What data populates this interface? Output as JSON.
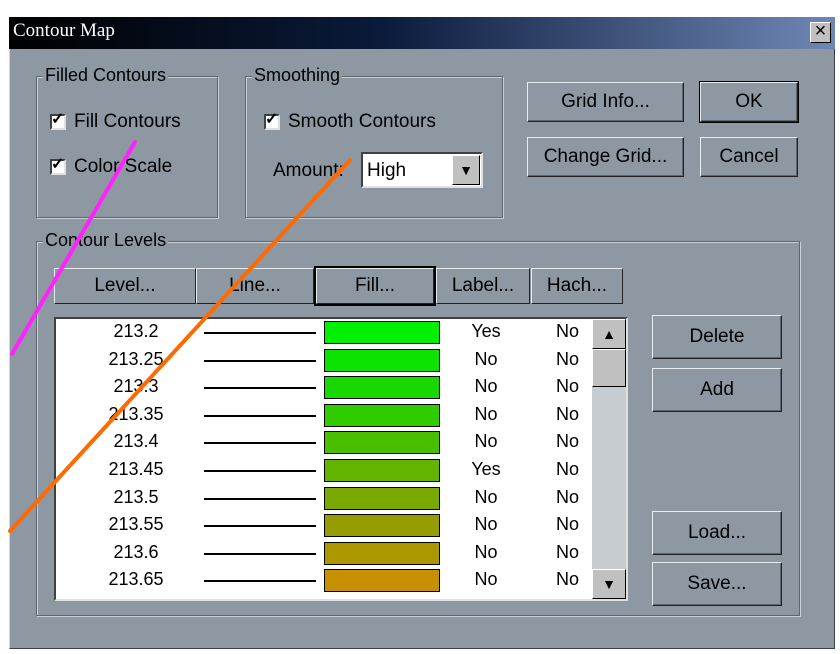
{
  "window": {
    "title": "Contour Map",
    "close_label": "×"
  },
  "filled": {
    "title": "Filled Contours",
    "fill_contours": {
      "label": "Fill Contours",
      "checked": true
    },
    "color_scale": {
      "label": "Color Scale",
      "checked": true
    }
  },
  "smoothing": {
    "title": "Smoothing",
    "smooth": {
      "label": "Smooth Contours",
      "checked": true
    },
    "amount_label": "Amount:",
    "amount_value": "High"
  },
  "buttons": {
    "grid_info": "Grid Info...",
    "ok": "OK",
    "change_grid": "Change Grid...",
    "cancel": "Cancel",
    "delete": "Delete",
    "add": "Add",
    "load": "Load...",
    "save": "Save..."
  },
  "levels": {
    "title": "Contour Levels",
    "headers": [
      "Level...",
      "Line...",
      "Fill...",
      "Label...",
      "Hach..."
    ],
    "rows": [
      {
        "level": "213.2",
        "label": "Yes",
        "hach": "No",
        "color": "#00f000"
      },
      {
        "level": "213.25",
        "label": "No",
        "hach": "No",
        "color": "#0ce300"
      },
      {
        "level": "213.3",
        "label": "No",
        "hach": "No",
        "color": "#19d800"
      },
      {
        "level": "213.35",
        "label": "No",
        "hach": "No",
        "color": "#30cc00"
      },
      {
        "level": "213.4",
        "label": "No",
        "hach": "No",
        "color": "#48c000"
      },
      {
        "level": "213.45",
        "label": "Yes",
        "hach": "No",
        "color": "#62b400"
      },
      {
        "level": "213.5",
        "label": "No",
        "hach": "No",
        "color": "#7aa800"
      },
      {
        "level": "213.55",
        "label": "No",
        "hach": "No",
        "color": "#969d00"
      },
      {
        "level": "213.6",
        "label": "No",
        "hach": "No",
        "color": "#ac9700"
      },
      {
        "level": "213.65",
        "label": "No",
        "hach": "No",
        "color": "#c69000"
      }
    ]
  },
  "annotation_colors": {
    "magenta": "#ff22ff",
    "orange": "#ff6a00"
  }
}
